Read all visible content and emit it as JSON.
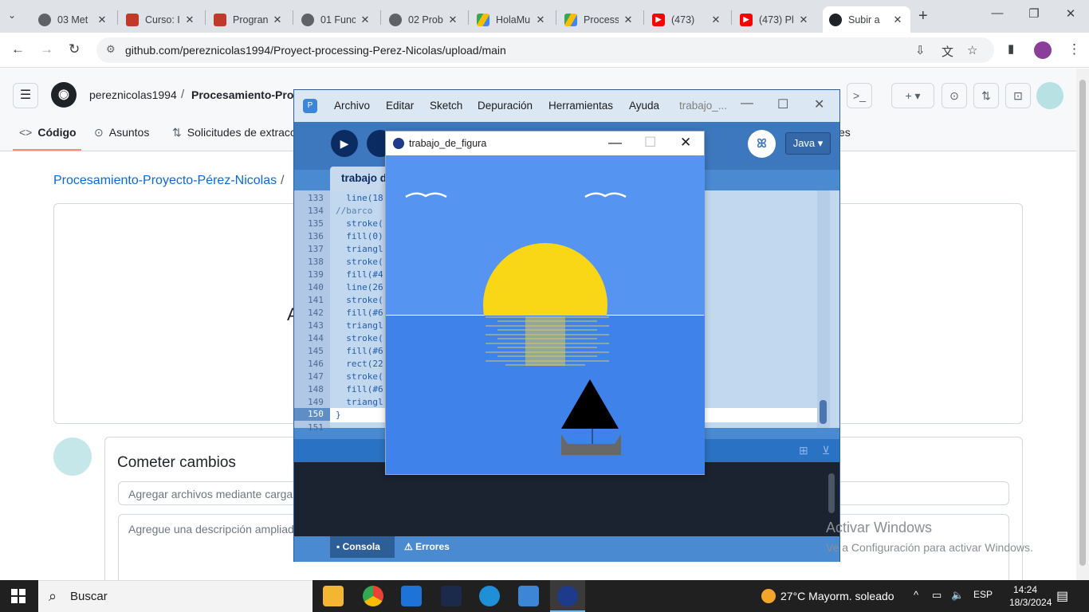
{
  "browser": {
    "tabs": [
      {
        "label": "03 Met",
        "favicon": "globe-icon",
        "color": "#5f6368"
      },
      {
        "label": "Curso: I",
        "favicon": "moodle-icon",
        "color": "#c0392b"
      },
      {
        "label": "Progran",
        "favicon": "moodle-icon",
        "color": "#c0392b"
      },
      {
        "label": "01 Func",
        "favicon": "globe-icon",
        "color": "#5f6368"
      },
      {
        "label": "02 Prob",
        "favicon": "globe-icon",
        "color": "#5f6368"
      },
      {
        "label": "HolaMu",
        "favicon": "drive-icon",
        "color": "#1a73e8"
      },
      {
        "label": "Process",
        "favicon": "drive-icon",
        "color": "#1a73e8"
      },
      {
        "label": "(473)",
        "favicon": "youtube-icon",
        "color": "#ff0000"
      },
      {
        "label": "(473) Pl",
        "favicon": "youtube-icon",
        "color": "#ff0000"
      },
      {
        "label": "Subir a",
        "favicon": "github-icon",
        "color": "#1f2328"
      }
    ],
    "url": "github.com/pereznicolas1994/Proyect-processing-Perez-Nicolas/upload/main",
    "profile_initial": "●"
  },
  "github": {
    "owner": "pereznicolas1994",
    "separator": "/",
    "repo": "Procesamiento-Proy",
    "repo_tabs": [
      "Código",
      "Asuntos",
      "Solicitudes de extracc",
      "es"
    ],
    "breadcrumb": "Procesamiento-Proyecto-Pérez-Nicolas",
    "breadcrumb_sep": "/",
    "drop_letter": "A",
    "commit_title": "Cometer cambios",
    "commit_summary_placeholder": "Agregar archivos mediante carga",
    "commit_desc_placeholder": "Agregue una descripción ampliad"
  },
  "processing": {
    "menus": [
      "Archivo",
      "Editar",
      "Sketch",
      "Depuración",
      "Herramientas",
      "Ayuda"
    ],
    "window_title": "trabajo_...",
    "tab_label": "trabajo d",
    "mode": "Java ▾",
    "lines": [
      {
        "n": "133",
        "code": "  line(18"
      },
      {
        "n": "134",
        "code": "//barco",
        "comment": true
      },
      {
        "n": "135",
        "code": "  stroke("
      },
      {
        "n": "136",
        "code": "  fill(0)"
      },
      {
        "n": "137",
        "code": "  triangl"
      },
      {
        "n": "138",
        "code": "  stroke("
      },
      {
        "n": "139",
        "code": "  fill(#4"
      },
      {
        "n": "140",
        "code": "  line(26"
      },
      {
        "n": "141",
        "code": "  stroke("
      },
      {
        "n": "142",
        "code": "  fill(#6"
      },
      {
        "n": "143",
        "code": "  triangl"
      },
      {
        "n": "144",
        "code": "  stroke("
      },
      {
        "n": "145",
        "code": "  fill(#6"
      },
      {
        "n": "146",
        "code": "  rect(22"
      },
      {
        "n": "147",
        "code": "  stroke("
      },
      {
        "n": "148",
        "code": "  fill(#6"
      },
      {
        "n": "149",
        "code": "  triangl"
      },
      {
        "n": "150",
        "code": "}",
        "current": true
      },
      {
        "n": "151",
        "code": ""
      }
    ],
    "console_tabs": [
      "Consola",
      "Errores"
    ]
  },
  "sketch": {
    "title": "trabajo_de_figura",
    "colors": {
      "sky": "#5594f0",
      "sea": "#3f82ea",
      "sun": "#f9d616",
      "boat": "#686868",
      "sail": "#000000"
    }
  },
  "activation": {
    "title": "Activar Windows",
    "subtitle": "Ve a Configuración para activar Windows."
  },
  "taskbar": {
    "search": "Buscar",
    "weather": "27°C  Mayorm. soleado",
    "lang": "ESP",
    "time": "14:24",
    "date": "18/3/2024"
  }
}
